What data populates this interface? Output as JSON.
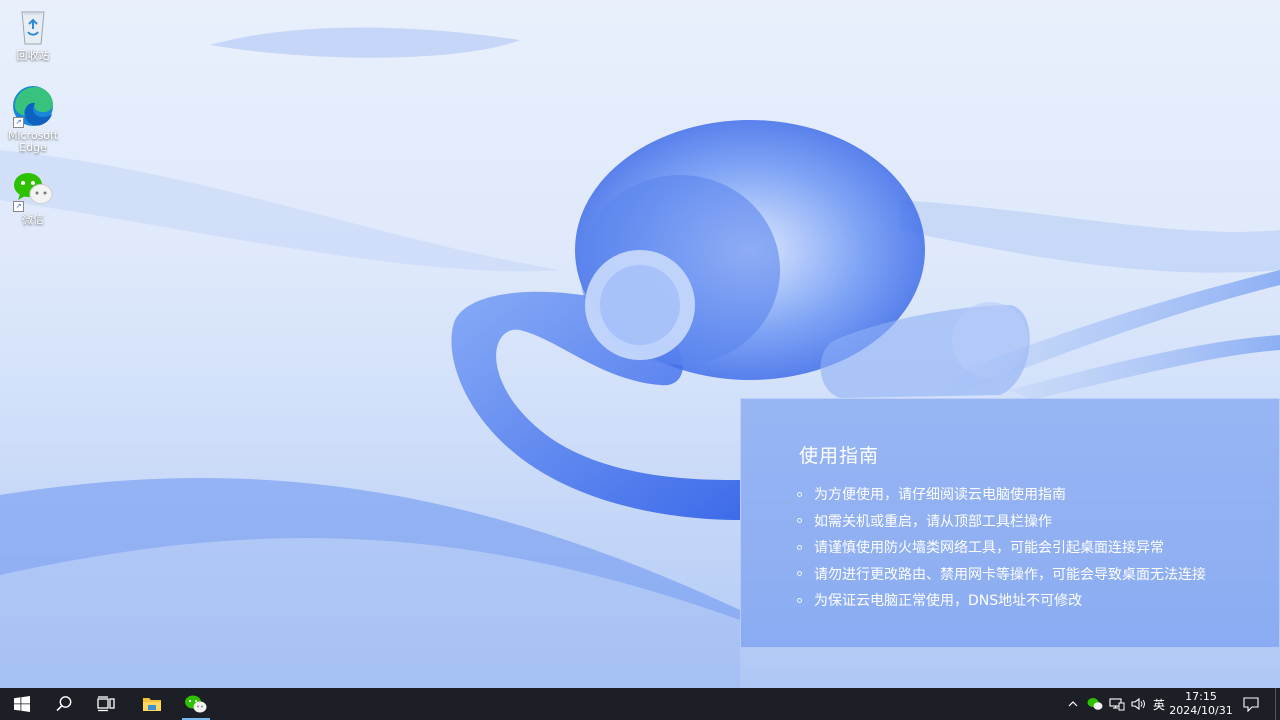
{
  "desktop": {
    "icons": [
      {
        "label": "回收站",
        "icon": "recycle-bin-icon"
      },
      {
        "label": "Microsoft Edge",
        "icon": "edge-icon"
      },
      {
        "label": "微信",
        "icon": "wechat-icon"
      }
    ]
  },
  "guide": {
    "title": "使用指南",
    "items": [
      "为方便使用，请仔细阅读云电脑使用指南",
      "如需关机或重启，请从顶部工具栏操作",
      "请谨慎使用防火墙类网络工具，可能会引起桌面连接异常",
      "请勿进行更改路由、禁用网卡等操作，可能会导致桌面无法连接",
      "为保证云电脑正常使用，DNS地址不可修改"
    ]
  },
  "taskbar": {
    "pinned": [
      {
        "name": "start",
        "icon": "windows-logo-icon"
      },
      {
        "name": "search",
        "icon": "search-icon"
      },
      {
        "name": "task-view",
        "icon": "task-view-icon"
      },
      {
        "name": "file-explorer",
        "icon": "folder-icon"
      },
      {
        "name": "wechat",
        "icon": "wechat-icon",
        "active": true
      }
    ],
    "tray": {
      "language": "英",
      "time": "17:15",
      "date": "2024/10/31"
    }
  },
  "colors": {
    "taskbar_bg": "#1c1f26",
    "accent": "#2f6cf0",
    "wechat_green": "#2dc100"
  }
}
